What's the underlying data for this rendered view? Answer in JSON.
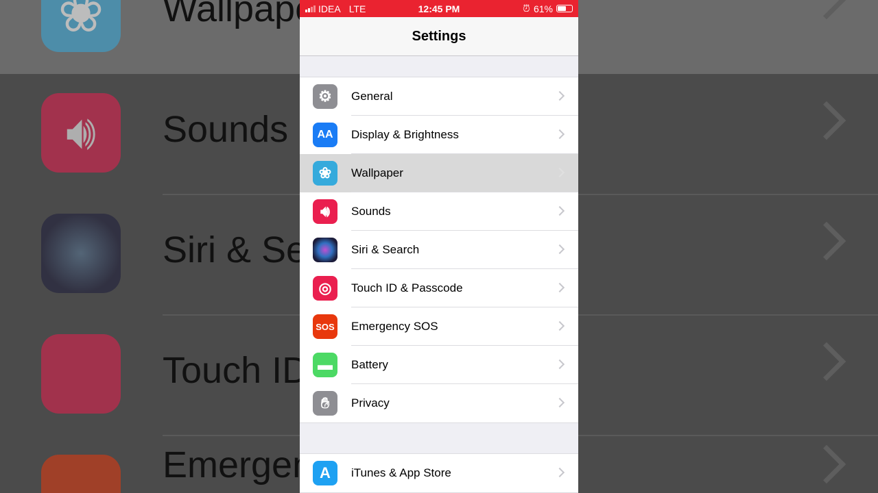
{
  "status_bar": {
    "carrier": "IDEA",
    "network": "LTE",
    "time": "12:45 PM",
    "battery": "61%",
    "battery_level": 0.61
  },
  "nav": {
    "title": "Settings"
  },
  "groups": [
    {
      "items": [
        {
          "label": "General",
          "icon": "gear-icon",
          "color": "#8e8e93"
        },
        {
          "label": "Display & Brightness",
          "icon": "text-size-icon",
          "color": "#1a7cf5"
        },
        {
          "label": "Wallpaper",
          "icon": "flower-icon",
          "color": "#35aadc",
          "highlighted": true
        },
        {
          "label": "Sounds",
          "icon": "speaker-icon",
          "color": "#ea1f4f"
        },
        {
          "label": "Siri & Search",
          "icon": "siri-icon",
          "color": "#1c1c3a"
        },
        {
          "label": "Touch ID & Passcode",
          "icon": "fingerprint-icon",
          "color": "#ea1f4f"
        },
        {
          "label": "Emergency SOS",
          "icon": "sos-icon",
          "color": "#e8380d",
          "glyph": "SOS"
        },
        {
          "label": "Battery",
          "icon": "battery-icon",
          "color": "#4cd964"
        },
        {
          "label": "Privacy",
          "icon": "hand-icon",
          "color": "#8e8e93"
        }
      ]
    },
    {
      "items": [
        {
          "label": "iTunes & App Store",
          "icon": "app-store-icon",
          "color": "#1ea1f2"
        }
      ]
    }
  ]
}
